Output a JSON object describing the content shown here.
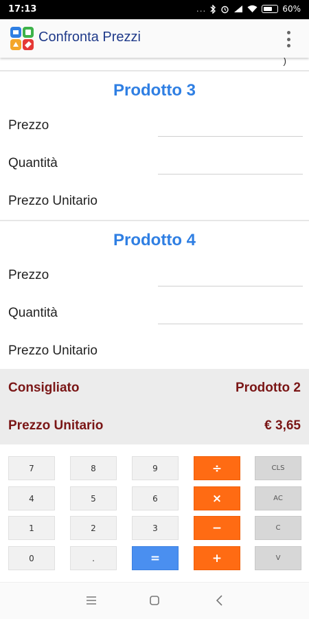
{
  "status_bar": {
    "time": "17:13",
    "indicators": "...",
    "battery": "60%",
    "icons": [
      "bluetooth-icon",
      "alarm-icon",
      "signal-icon",
      "wifi-icon",
      "battery-icon"
    ]
  },
  "app_bar": {
    "title": "Confronta Prezzi",
    "logo_icon": "app-logo-icon",
    "menu_icon": "overflow-menu-icon"
  },
  "products": [
    {
      "title": "Prodotto 3",
      "price_label": "Prezzo",
      "price_value": "",
      "quantity_label": "Quantità",
      "quantity_value": "",
      "unit_price_label": "Prezzo Unitario",
      "unit_price_value": ""
    },
    {
      "title": "Prodotto 4",
      "price_label": "Prezzo",
      "price_value": "",
      "quantity_label": "Quantità",
      "quantity_value": "",
      "unit_price_label": "Prezzo Unitario",
      "unit_price_value": ""
    }
  ],
  "result": {
    "recommended_label": "Consigliato",
    "recommended_value": "Prodotto 2",
    "unit_price_label": "Prezzo Unitario",
    "unit_price_value": "€ 3,65"
  },
  "keypad": {
    "rows": [
      [
        "7",
        "8",
        "9",
        "÷",
        "CLS"
      ],
      [
        "4",
        "5",
        "6",
        "×",
        "AC"
      ],
      [
        "1",
        "2",
        "3",
        "−",
        "C"
      ],
      [
        "0",
        ".",
        "=",
        "+",
        "V"
      ]
    ],
    "colors": {
      "operator": "#ff6b13",
      "equals": "#4a8ff0",
      "function": "#d7d7d7",
      "digit": "#f1f1f1"
    }
  },
  "nav_bar": {
    "icons": [
      "menu-icon",
      "home-icon",
      "back-icon"
    ]
  },
  "colors": {
    "product_title": "#2f7fe3",
    "result_text": "#7a1616",
    "app_title": "#1f3a8a"
  }
}
